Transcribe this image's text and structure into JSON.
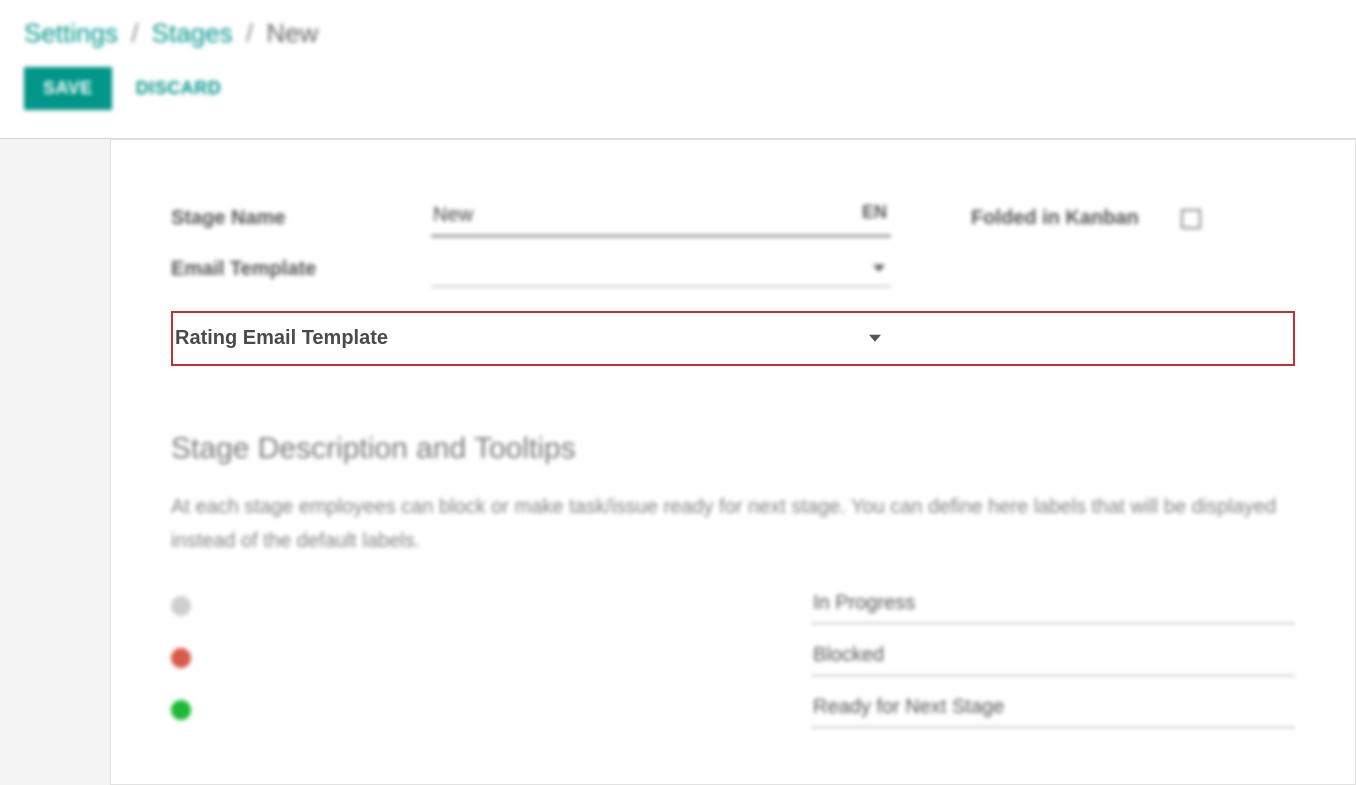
{
  "breadcrumb": {
    "root": "Settings",
    "mid": "Stages",
    "current": "New",
    "sep": "/"
  },
  "actions": {
    "save": "SAVE",
    "discard": "DISCARD"
  },
  "form": {
    "stage_name_label": "Stage Name",
    "stage_name_value": "New",
    "lang": "EN",
    "email_template_label": "Email Template",
    "email_template_value": "",
    "rating_template_label": "Rating Email Template",
    "rating_template_value": "",
    "folded_label": "Folded in Kanban"
  },
  "section": {
    "title": "Stage Description and Tooltips",
    "desc": "At each stage employees can block or make task/issue ready for next stage. You can define here labels that will be displayed instead of the default labels."
  },
  "statuses": {
    "grey": "In Progress",
    "red": "Blocked",
    "green": "Ready for Next Stage"
  }
}
